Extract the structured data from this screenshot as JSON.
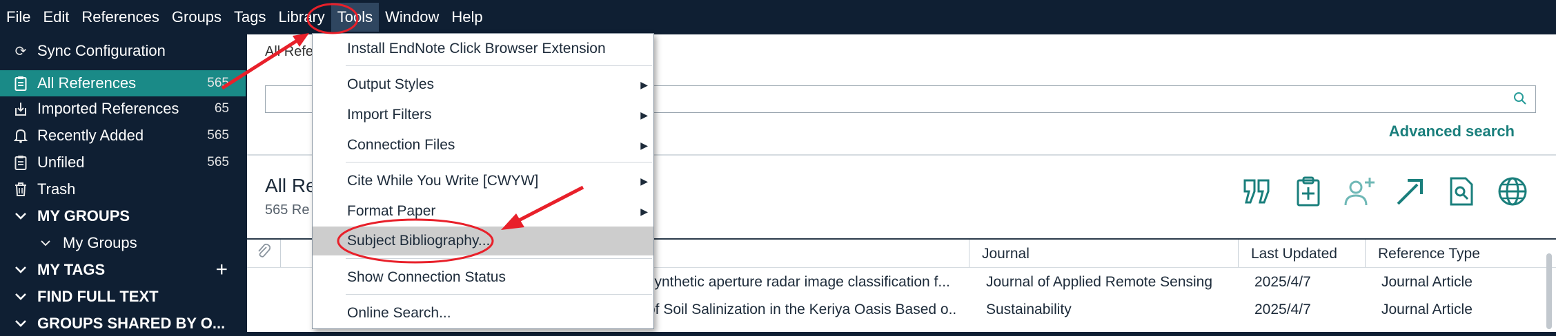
{
  "menubar": {
    "items": [
      "File",
      "Edit",
      "References",
      "Groups",
      "Tags",
      "Library",
      "Tools",
      "Window",
      "Help"
    ]
  },
  "sidebar": {
    "sync": "Sync Configuration",
    "items": [
      {
        "label": "All References",
        "count": "565",
        "icon": "clipboard-icon"
      },
      {
        "label": "Imported References",
        "count": "65",
        "icon": "download-icon"
      },
      {
        "label": "Recently Added",
        "count": "565",
        "icon": "bell-icon"
      },
      {
        "label": "Unfiled",
        "count": "565",
        "icon": "clipboard-icon"
      },
      {
        "label": "Trash",
        "count": "",
        "icon": "trash-icon"
      }
    ],
    "my_groups": "MY GROUPS",
    "my_groups_sub": "My Groups",
    "my_tags": "MY TAGS",
    "find_full_text": "FIND FULL TEXT",
    "groups_shared": "GROUPS SHARED BY O..."
  },
  "main": {
    "breadcrumb": "All Refere",
    "advanced_search": "Advanced search",
    "library_title": "All Re",
    "library_subtitle": "565 Re",
    "columns": [
      "Journal",
      "Last Updated",
      "Reference Type"
    ],
    "rows": [
      {
        "title": "synthetic aperture radar image classification f...",
        "journal": "Journal of Applied Remote Sensing",
        "updated": "2025/4/7",
        "type": "Journal Article"
      },
      {
        "title": "of Soil Salinization in the Keriya Oasis Based o...",
        "journal": "Sustainability",
        "updated": "2025/4/7",
        "type": "Journal Article"
      }
    ]
  },
  "tools_menu": {
    "items": [
      {
        "label": "Install EndNote Click Browser Extension",
        "submenu": false
      },
      {
        "label": "Output Styles",
        "submenu": true
      },
      {
        "label": "Import Filters",
        "submenu": true
      },
      {
        "label": "Connection Files",
        "submenu": true
      },
      {
        "label": "Cite While You Write [CWYW]",
        "submenu": true
      },
      {
        "label": "Format Paper",
        "submenu": true
      },
      {
        "label": "Subject Bibliography...",
        "submenu": false,
        "highlighted": true
      },
      {
        "label": "Show Connection Status",
        "submenu": false
      },
      {
        "label": "Online Search...",
        "submenu": false
      }
    ]
  },
  "colors": {
    "sidebar_bg": "#0f1f33",
    "selected": "#1a8a87",
    "accent": "#1a7f7c",
    "annotation": "#e8202a"
  }
}
